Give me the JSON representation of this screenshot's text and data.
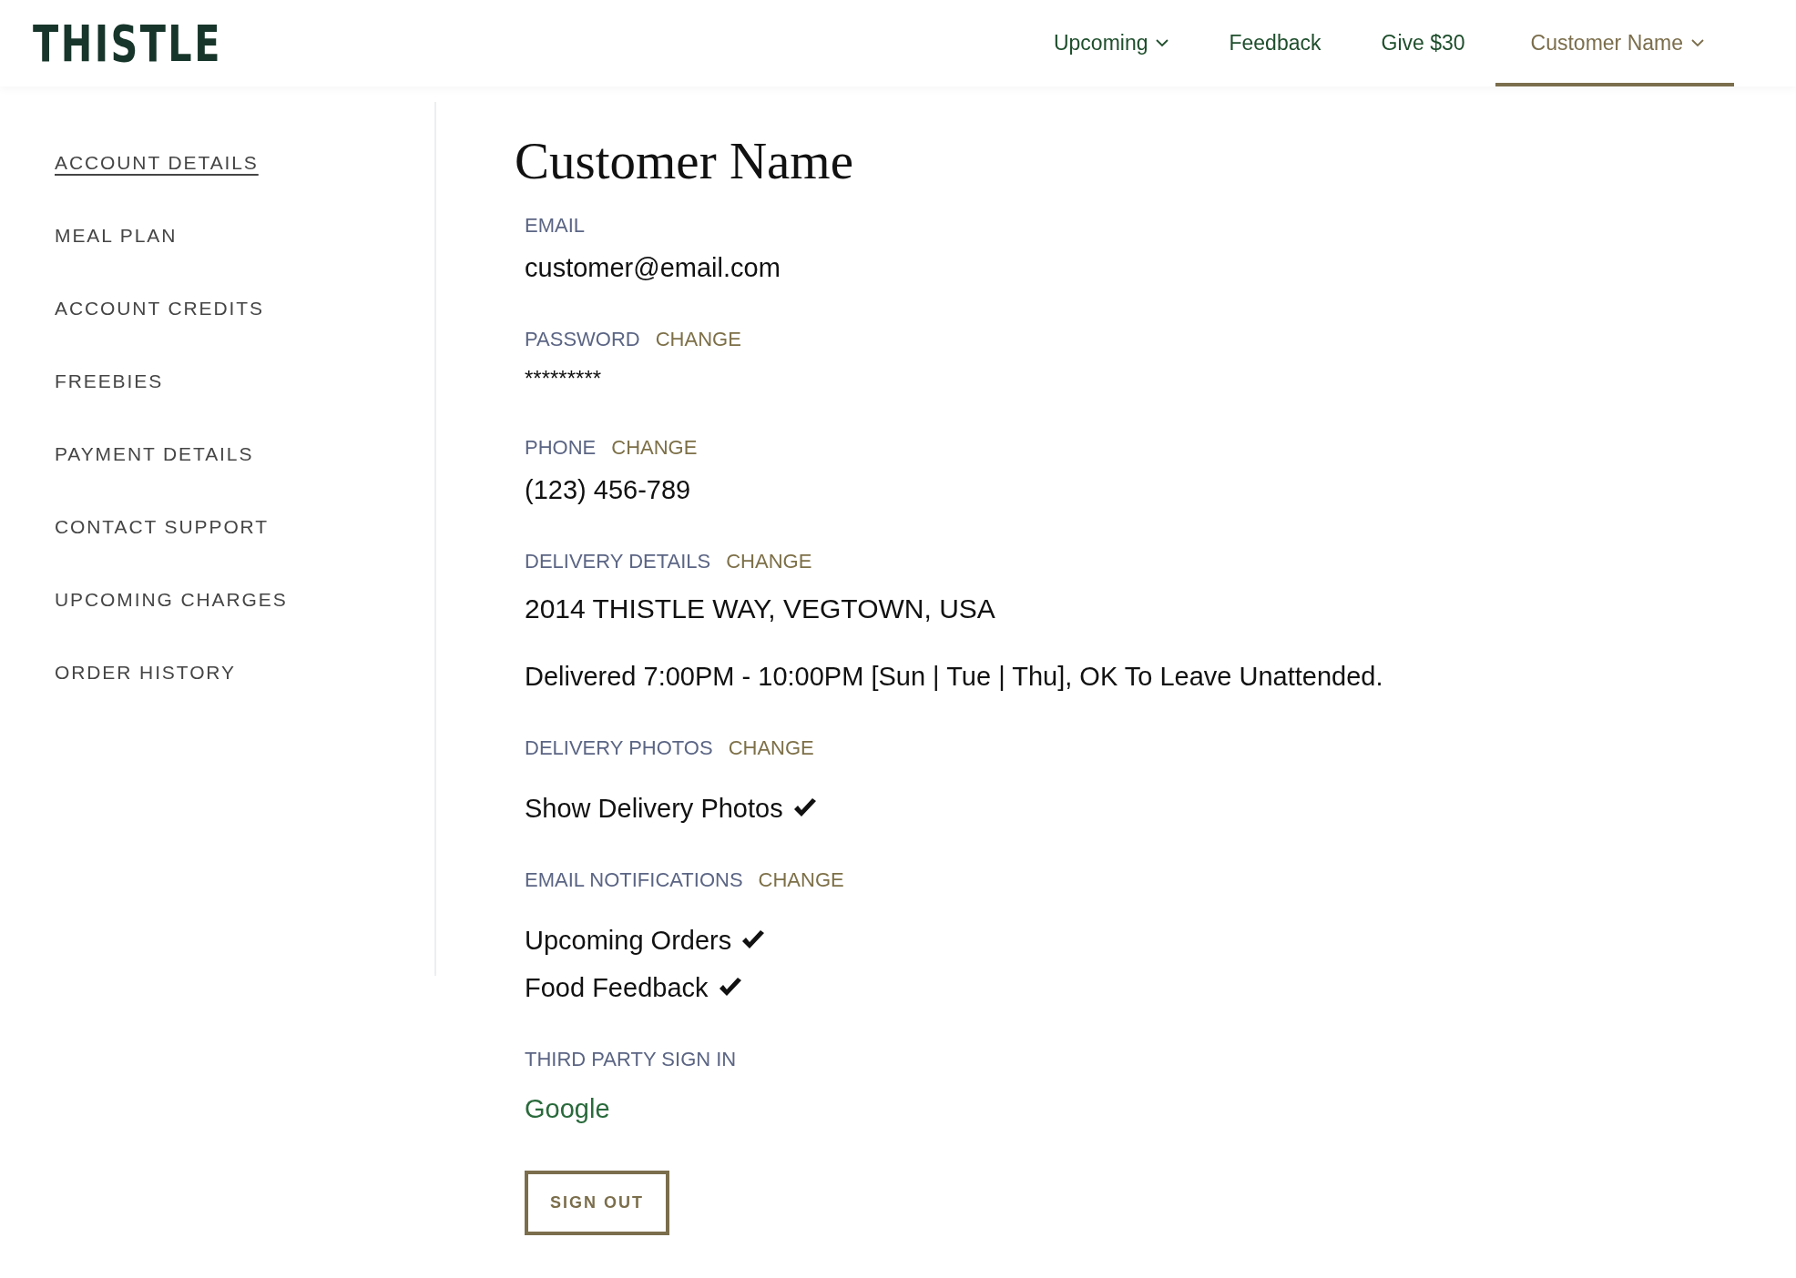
{
  "logo": "THISTLE",
  "nav": [
    {
      "label": "Upcoming",
      "dropdown": true,
      "selected": false
    },
    {
      "label": "Feedback",
      "dropdown": false,
      "selected": false
    },
    {
      "label": "Give $30",
      "dropdown": false,
      "selected": false
    },
    {
      "label": "Customer Name",
      "dropdown": true,
      "selected": true
    }
  ],
  "sidebar": {
    "items": [
      {
        "label": "ACCOUNT DETAILS",
        "selected": true
      },
      {
        "label": "MEAL PLAN",
        "selected": false
      },
      {
        "label": "ACCOUNT CREDITS",
        "selected": false
      },
      {
        "label": "FREEBIES",
        "selected": false
      },
      {
        "label": "PAYMENT DETAILS",
        "selected": false
      },
      {
        "label": "CONTACT SUPPORT",
        "selected": false
      },
      {
        "label": "UPCOMING CHARGES",
        "selected": false
      },
      {
        "label": "ORDER HISTORY",
        "selected": false
      }
    ]
  },
  "heading": "Customer Name",
  "sections": [
    {
      "label": "EMAIL",
      "items": [
        {
          "kind": "text",
          "text": "customer@email.com"
        }
      ]
    },
    {
      "label": "PASSWORD",
      "change": "CHANGE",
      "items": [
        {
          "kind": "masked",
          "text": "*********"
        }
      ]
    },
    {
      "label": "PHONE",
      "change": "CHANGE",
      "items": [
        {
          "kind": "text",
          "text": "(123) 456-789"
        }
      ]
    },
    {
      "label": "DELIVERY DETAILS",
      "change": "CHANGE",
      "items": [
        {
          "kind": "address",
          "text": "2014 THISTLE WAY, VEGTOWN, USA"
        },
        {
          "kind": "note",
          "text": "Delivered 7:00PM - 10:00PM [Sun | Tue | Thu], OK To Leave Unattended."
        }
      ]
    },
    {
      "label": "DELIVERY PHOTOS",
      "change": "CHANGE",
      "items": [
        {
          "kind": "check",
          "text": "Show Delivery Photos",
          "checked": true
        }
      ]
    },
    {
      "label": "EMAIL NOTIFICATIONS",
      "change": "CHANGE",
      "items": [
        {
          "kind": "check",
          "text": "Upcoming Orders",
          "checked": true
        },
        {
          "kind": "check",
          "text": "Food Feedback",
          "checked": true
        }
      ]
    },
    {
      "label": "THIRD PARTY SIGN IN",
      "items": [
        {
          "kind": "link",
          "text": "Google"
        }
      ]
    }
  ],
  "sign_out": "SIGN OUT"
}
